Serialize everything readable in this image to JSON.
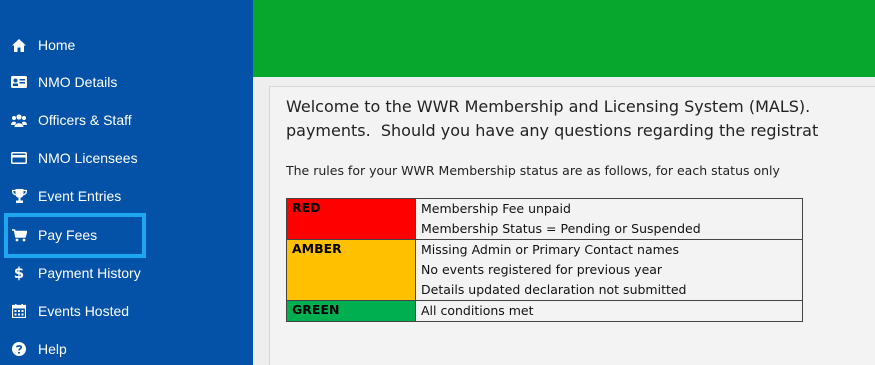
{
  "sidebar": {
    "items": [
      {
        "label": "Home",
        "icon": "home-icon"
      },
      {
        "label": "NMO Details",
        "icon": "id-card-icon"
      },
      {
        "label": "Officers & Staff",
        "icon": "users-icon"
      },
      {
        "label": "NMO Licensees",
        "icon": "credit-card-icon"
      },
      {
        "label": "Event Entries",
        "icon": "trophy-icon"
      },
      {
        "label": "Pay Fees",
        "icon": "cart-icon"
      },
      {
        "label": "Payment History",
        "icon": "dollar-icon"
      },
      {
        "label": "Events Hosted",
        "icon": "calendar-icon"
      },
      {
        "label": "Help",
        "icon": "question-icon"
      }
    ]
  },
  "content": {
    "welcome_line1": "Welcome to the WWR Membership and Licensing System (MALS).",
    "welcome_line2": "payments.  Should you have any questions regarding the registrat",
    "rules_intro": "The rules for your WWR Membership status are as follows, for each status only",
    "statuses": [
      {
        "name": "RED",
        "conditions": [
          "Membership Fee unpaid",
          "Membership Status = Pending or Suspended"
        ]
      },
      {
        "name": "AMBER",
        "conditions": [
          "Missing Admin or Primary Contact names",
          "No events registered for previous year",
          "Details updated declaration not submitted"
        ]
      },
      {
        "name": "GREEN",
        "conditions": [
          "All conditions met"
        ]
      }
    ]
  },
  "colors": {
    "sidebar_bg": "#0451a8",
    "topbar_bg": "#07a62d",
    "highlight": "#1fa6f0",
    "red": "#ff0000",
    "amber": "#ffc000",
    "green": "#00b050"
  }
}
